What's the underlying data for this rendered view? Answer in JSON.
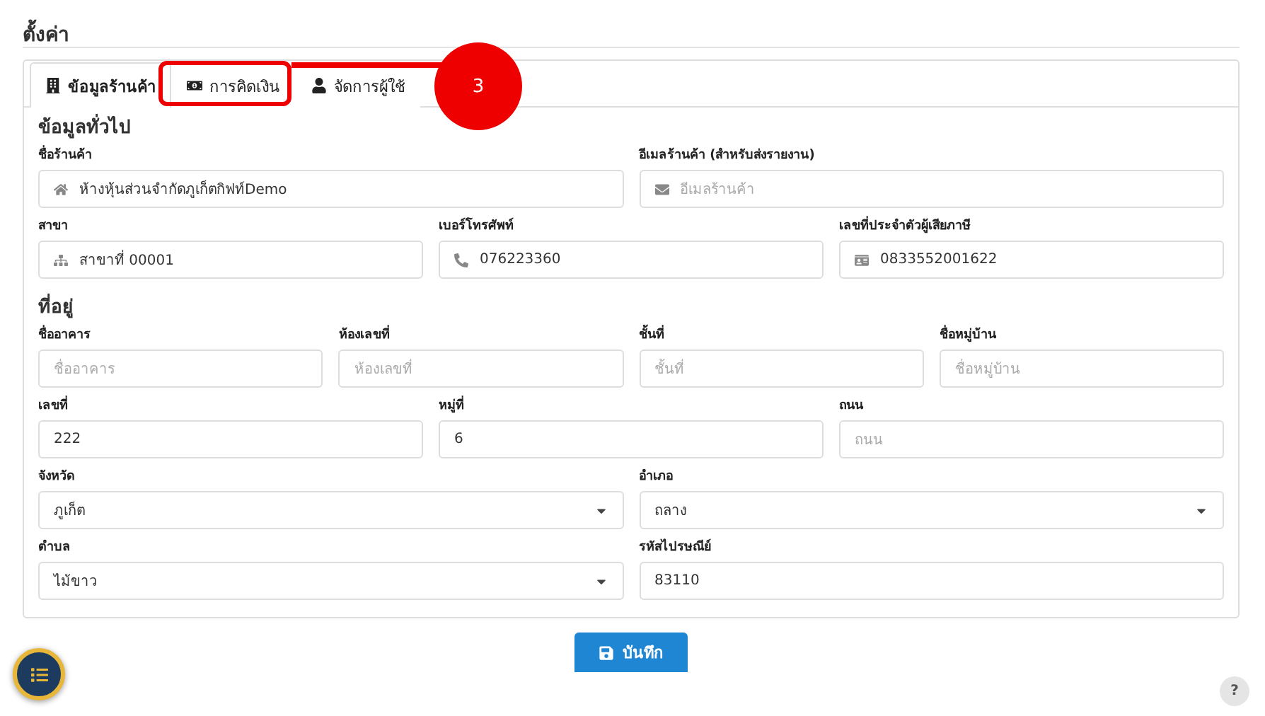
{
  "page": {
    "title": "ตั้งค่า"
  },
  "tabs": [
    {
      "label": "ข้อมูลร้านค้า",
      "selected": true
    },
    {
      "label": "การคิดเงิน",
      "selected": false
    },
    {
      "label": "จัดการผู้ใช้",
      "selected": false
    }
  ],
  "annotation": {
    "number": "3"
  },
  "sections": [
    {
      "title": "ข้อมูลทั่วไป",
      "rows": [
        {
          "fields": [
            {
              "label": "ชื่อร้านค้า",
              "kind": "input",
              "value": "ห้างหุ้นส่วนจำกัดภูเก็ตกิฟท์Demo"
            },
            {
              "label": "อีเมลร้านค้า (สำหรับส่งรายงาน)",
              "kind": "input",
              "placeholder": "อีเมลร้านค้า"
            }
          ]
        },
        {
          "fields": [
            {
              "label": "สาขา",
              "kind": "input",
              "value": "สาขาที่ 00001"
            },
            {
              "label": "เบอร์โทรศัพท์",
              "kind": "input",
              "value": "076223360"
            },
            {
              "label": "เลขที่ประจำตัวผู้เสียภาษี",
              "kind": "input",
              "value": "0833552001622"
            }
          ]
        }
      ]
    },
    {
      "title": "ที่อยู่",
      "rows": [
        {
          "fields": [
            {
              "label": "ชื่ออาคาร",
              "kind": "input",
              "placeholder": "ชื่ออาคาร"
            },
            {
              "label": "ห้องเลขที่",
              "kind": "input",
              "placeholder": "ห้องเลขที่"
            },
            {
              "label": "ชั้นที่",
              "kind": "input",
              "placeholder": "ชั้นที่"
            },
            {
              "label": "ชื่อหมู่บ้าน",
              "kind": "input",
              "placeholder": "ชื่อหมู่บ้าน"
            }
          ]
        },
        {
          "fields": [
            {
              "label": "เลขที่",
              "kind": "input",
              "value": "222"
            },
            {
              "label": "หมู่ที่",
              "kind": "input",
              "value": "6"
            },
            {
              "label": "ถนน",
              "kind": "input",
              "placeholder": "ถนน"
            }
          ]
        },
        {
          "fields": [
            {
              "label": "จังหวัด",
              "kind": "select",
              "value": "ภูเก็ต"
            },
            {
              "label": "อำเภอ",
              "kind": "select",
              "value": "ถลาง"
            }
          ]
        },
        {
          "fields": [
            {
              "label": "ตำบล",
              "kind": "select",
              "value": "ไม้ขาว"
            },
            {
              "label": "รหัสไปรษณีย์",
              "kind": "input",
              "value": "83110"
            }
          ]
        }
      ]
    }
  ],
  "save_button": {
    "label": "บันทึก"
  },
  "help_button": {
    "label": "?"
  }
}
